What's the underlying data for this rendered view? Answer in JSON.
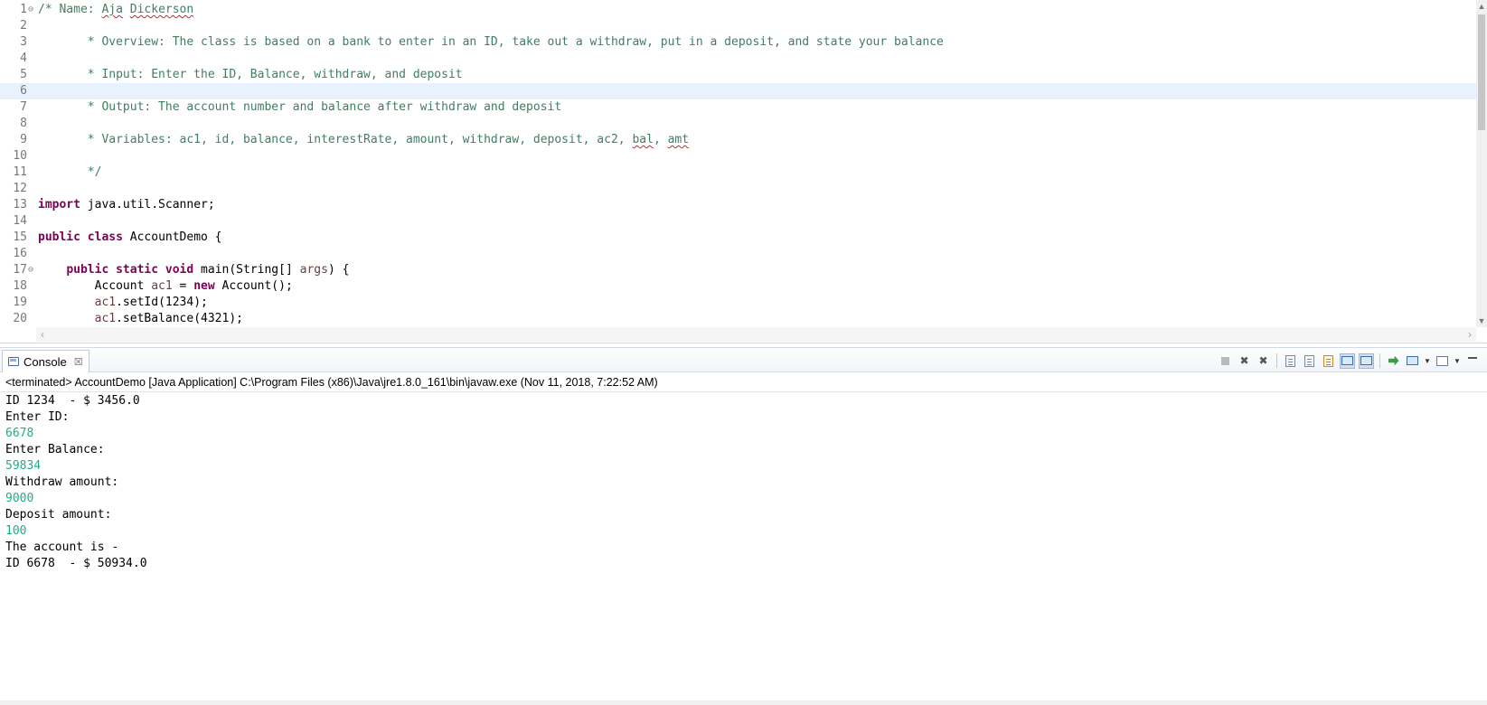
{
  "editor": {
    "lines": [
      {
        "num": "1",
        "fold": "⊖",
        "tokens": [
          {
            "t": "/* Name: ",
            "c": "comment"
          },
          {
            "t": "Aja",
            "c": "comment",
            "spell": true
          },
          {
            "t": " ",
            "c": "comment"
          },
          {
            "t": "Dickerson",
            "c": "comment",
            "spell": true
          }
        ]
      },
      {
        "num": "2",
        "tokens": []
      },
      {
        "num": "3",
        "tokens": [
          {
            "t": "       * Overview: The class is based on a bank to enter in an ID, take out a withdraw, put in a deposit, and state your balance",
            "c": "comment"
          }
        ]
      },
      {
        "num": "4",
        "tokens": []
      },
      {
        "num": "5",
        "tokens": [
          {
            "t": "       * Input: Enter the ID, Balance, withdraw, and deposit",
            "c": "comment"
          }
        ]
      },
      {
        "num": "6",
        "current": true,
        "tokens": []
      },
      {
        "num": "7",
        "tokens": [
          {
            "t": "       * Output: The account number and balance after withdraw and deposit",
            "c": "comment"
          }
        ]
      },
      {
        "num": "8",
        "tokens": []
      },
      {
        "num": "9",
        "tokens": [
          {
            "t": "       * Variables: ac1, id, balance, interestRate, amount, withdraw, deposit, ac2, ",
            "c": "comment"
          },
          {
            "t": "bal",
            "c": "comment",
            "spell": true
          },
          {
            "t": ", ",
            "c": "comment"
          },
          {
            "t": "amt",
            "c": "comment",
            "spell": true
          }
        ]
      },
      {
        "num": "10",
        "tokens": []
      },
      {
        "num": "11",
        "tokens": [
          {
            "t": "       */",
            "c": "comment"
          }
        ]
      },
      {
        "num": "12",
        "tokens": []
      },
      {
        "num": "13",
        "tokens": [
          {
            "t": "import",
            "c": "kw"
          },
          {
            "t": " java.util.Scanner;",
            "c": "plain"
          }
        ]
      },
      {
        "num": "14",
        "tokens": []
      },
      {
        "num": "15",
        "tokens": [
          {
            "t": "public",
            "c": "kw"
          },
          {
            "t": " ",
            "c": "plain"
          },
          {
            "t": "class",
            "c": "kw"
          },
          {
            "t": " AccountDemo {",
            "c": "plain"
          }
        ]
      },
      {
        "num": "16",
        "tokens": []
      },
      {
        "num": "17",
        "fold": "⊖",
        "tokens": [
          {
            "t": "    ",
            "c": "plain"
          },
          {
            "t": "public",
            "c": "kw"
          },
          {
            "t": " ",
            "c": "plain"
          },
          {
            "t": "static",
            "c": "kw"
          },
          {
            "t": " ",
            "c": "plain"
          },
          {
            "t": "void",
            "c": "kw"
          },
          {
            "t": " main(String[] ",
            "c": "plain"
          },
          {
            "t": "args",
            "c": "var"
          },
          {
            "t": ") {",
            "c": "plain"
          }
        ]
      },
      {
        "num": "18",
        "tokens": [
          {
            "t": "        Account ",
            "c": "plain"
          },
          {
            "t": "ac1",
            "c": "var"
          },
          {
            "t": " = ",
            "c": "plain"
          },
          {
            "t": "new",
            "c": "kw"
          },
          {
            "t": " Account();",
            "c": "plain"
          }
        ]
      },
      {
        "num": "19",
        "tokens": [
          {
            "t": "        ",
            "c": "plain"
          },
          {
            "t": "ac1",
            "c": "var"
          },
          {
            "t": ".setId(1234);",
            "c": "plain"
          }
        ]
      },
      {
        "num": "20",
        "tokens": [
          {
            "t": "        ",
            "c": "plain"
          },
          {
            "t": "ac1",
            "c": "var"
          },
          {
            "t": ".setBalance(4321);",
            "c": "plain"
          }
        ]
      }
    ]
  },
  "console": {
    "tab_label": "Console",
    "tab_close": "☒",
    "status": "<terminated> AccountDemo [Java Application] C:\\Program Files (x86)\\Java\\jre1.8.0_161\\bin\\javaw.exe (Nov 11, 2018, 7:22:52 AM)",
    "output": [
      {
        "text": "ID 1234  - $ 3456.0",
        "kind": "stdout"
      },
      {
        "text": "Enter ID:",
        "kind": "stdout"
      },
      {
        "text": "6678",
        "kind": "stdin"
      },
      {
        "text": "Enter Balance:",
        "kind": "stdout"
      },
      {
        "text": "59834",
        "kind": "stdin"
      },
      {
        "text": "Withdraw amount:",
        "kind": "stdout"
      },
      {
        "text": "9000",
        "kind": "stdin"
      },
      {
        "text": "Deposit amount:",
        "kind": "stdout"
      },
      {
        "text": "100",
        "kind": "stdin"
      },
      {
        "text": "The account is -",
        "kind": "stdout"
      },
      {
        "text": "ID 6678  - $ 50934.0",
        "kind": "stdout"
      }
    ],
    "colors": {
      "stdout": "#000000",
      "stdin": "#1ab08a"
    }
  },
  "colors": {
    "comment": "#3f7f5f",
    "keyword": "#7f0055",
    "variable": "#6a3e3e",
    "current_line": "#e8f2fe"
  },
  "toolbar_icons": [
    "terminate-icon",
    "remove-launch-icon",
    "remove-all-terminated-icon",
    "clear-console-icon",
    "scroll-lock-icon",
    "word-wrap-icon",
    "show-on-stdout-icon",
    "show-on-stderr-icon",
    "pin-console-icon",
    "display-console-icon",
    "open-console-icon",
    "minimize-icon"
  ]
}
